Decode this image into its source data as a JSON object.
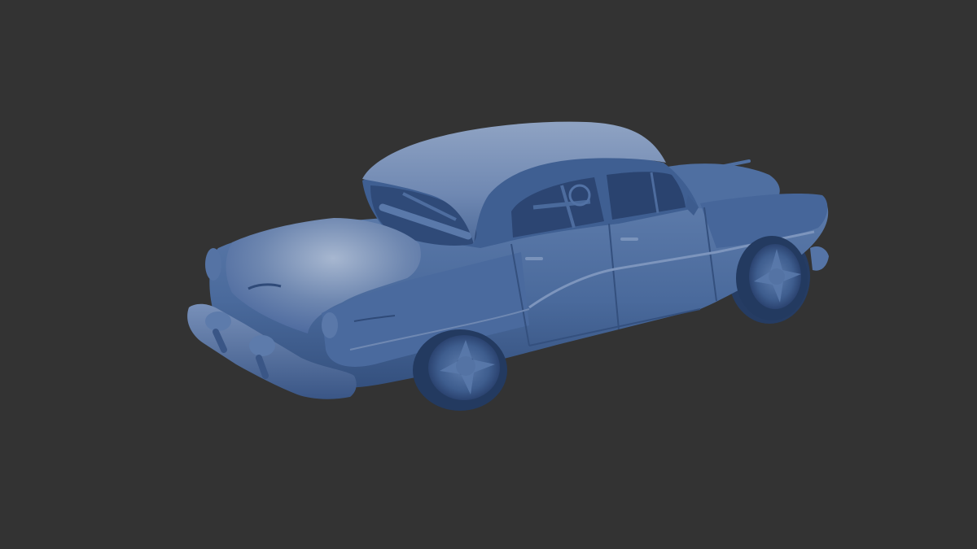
{
  "viewport": {
    "background_color": "#333333",
    "subject": "car-model",
    "model_color": "#3f5f90",
    "model_highlight_color": "#8fa3c3",
    "model_shadow_color": "#2d456c"
  }
}
